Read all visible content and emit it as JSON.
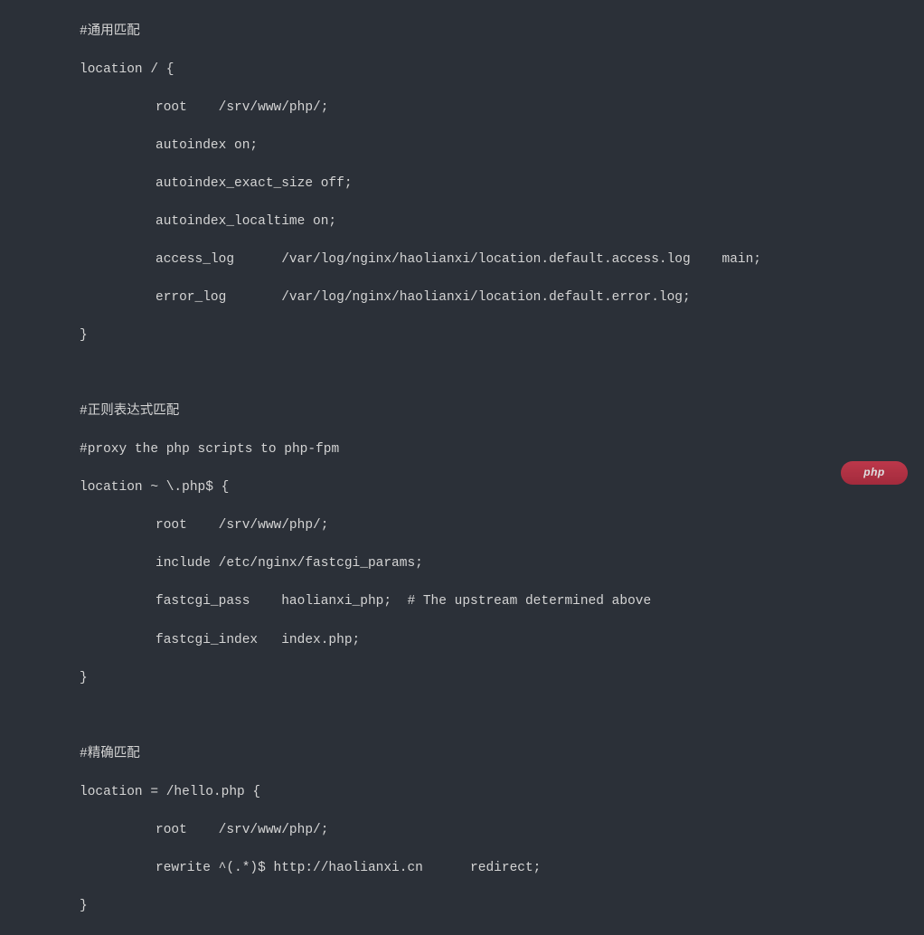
{
  "code": {
    "comment1": "#通用匹配",
    "loc1_open": "location / {",
    "loc1_root": "root    /srv/www/php/;",
    "loc1_autoindex": "autoindex on;",
    "loc1_exact": "autoindex_exact_size off;",
    "loc1_localtime": "autoindex_localtime on;",
    "loc1_access": "access_log      /var/log/nginx/haolianxi/location.default.access.log    main;",
    "loc1_error": "error_log       /var/log/nginx/haolianxi/location.default.error.log;",
    "loc1_close": "}",
    "comment2": "#正则表达式匹配",
    "comment3": "#proxy the php scripts to php-fpm",
    "loc2_open": "location ~ \\.php$ {",
    "loc2_root": "root    /srv/www/php/;",
    "loc2_include": "include /etc/nginx/fastcgi_params;",
    "loc2_pass": "fastcgi_pass    haolianxi_php;  # The upstream determined above",
    "loc2_index": "fastcgi_index   index.php;",
    "loc2_close": "}",
    "comment4": "#精确匹配",
    "loc3_open": "location = /hello.php {",
    "loc3_root": "root    /srv/www/php/;",
    "loc3_rewrite": "rewrite ^(.*)$ http://haolianxi.cn      redirect;",
    "loc3_close": "}"
  },
  "watermark": {
    "text": "php"
  }
}
